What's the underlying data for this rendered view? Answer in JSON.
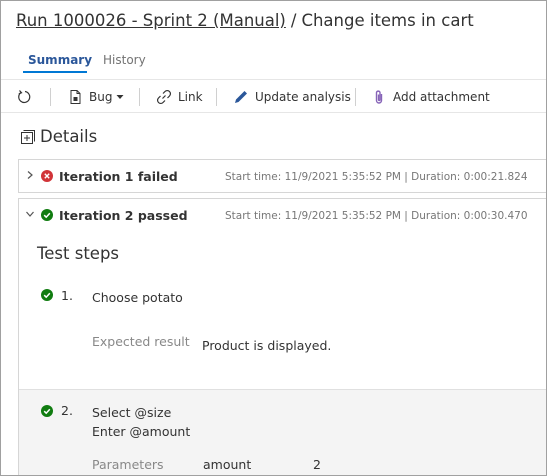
{
  "header": {
    "run_link": "Run 1000026 - Sprint 2 (Manual)",
    "separator": "/",
    "page_title": "Change items in cart"
  },
  "tabs": [
    {
      "label": "Summary",
      "active": true
    },
    {
      "label": "History",
      "active": false
    }
  ],
  "toolbar": {
    "refresh_icon": "refresh-icon",
    "bug_label": "Bug",
    "link_label": "Link",
    "update_analysis_label": "Update analysis",
    "add_attachment_label": "Add attachment"
  },
  "details": {
    "title": "Details"
  },
  "iterations": [
    {
      "title": "Iteration 1 failed",
      "status": "failed",
      "expanded": false,
      "meta": "Start time: 11/9/2021 5:35:52 PM | Duration: 0:00:21.824"
    },
    {
      "title": "Iteration 2 passed",
      "status": "passed",
      "expanded": true,
      "meta": "Start time: 11/9/2021 5:35:52 PM | Duration: 0:00:30.470"
    }
  ],
  "test_steps": {
    "title": "Test steps",
    "steps": [
      {
        "number": "1.",
        "action_lines": [
          "Choose potato"
        ],
        "expected_label": "Expected result",
        "expected_value": "Product is displayed."
      },
      {
        "number": "2.",
        "action_lines": [
          "Select @size",
          "Enter @amount"
        ],
        "parameters_label": "Parameters",
        "param_name": "amount",
        "param_value": "2"
      }
    ]
  },
  "colors": {
    "accent": "#0078d4",
    "passed": "#107c10",
    "failed": "#d13438",
    "attachment_icon": "#8764b8"
  }
}
